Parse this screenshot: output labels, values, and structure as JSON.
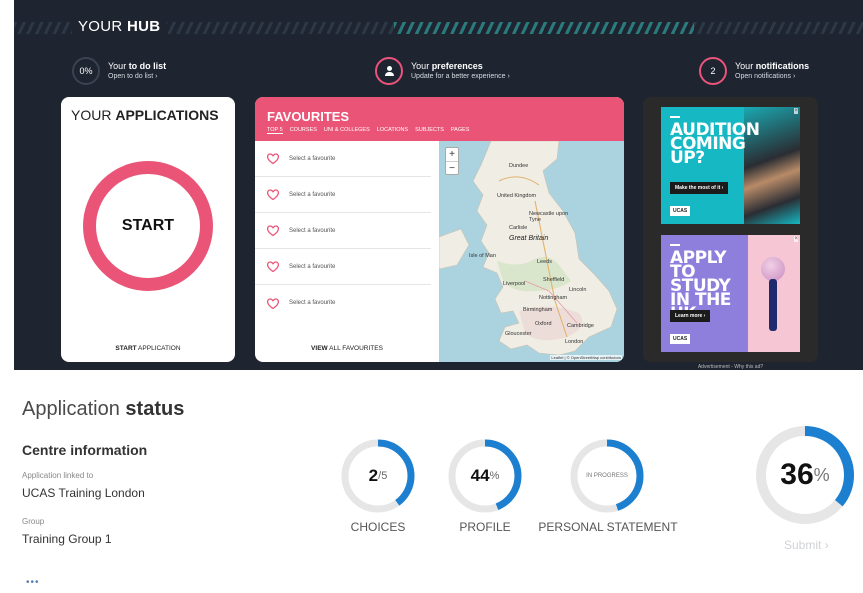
{
  "hub": {
    "title_prefix": "YOUR ",
    "title_bold": "HUB",
    "todo": {
      "circle": "0%",
      "prefix": "Your ",
      "bold": "to do list",
      "link": "Open to do list ›"
    },
    "preferences": {
      "prefix": "Your ",
      "bold": "preferences",
      "link": "Update for a better experience ›"
    },
    "notifications": {
      "circle": "2",
      "prefix": "Your ",
      "bold": "notifications",
      "link": "Open notifications ›"
    }
  },
  "applications": {
    "title_prefix": "YOUR ",
    "title_bold": "APPLICATIONS",
    "start": "START",
    "link_bold": "START",
    "link_rest": " APPLICATION"
  },
  "favourites": {
    "title": "FAVOURITES",
    "tabs": [
      "TOP 5",
      "COURSES",
      "UNI & COLLEGES",
      "LOCATIONS",
      "SUBJECTS",
      "PAGES"
    ],
    "items": [
      "Select a favourite",
      "Select a favourite",
      "Select a favourite",
      "Select a favourite",
      "Select a favourite"
    ],
    "view_bold": "VIEW",
    "view_rest": " ALL FAVOURITES",
    "map": {
      "zoom_in": "+",
      "zoom_out": "−",
      "labels": [
        "Dundee",
        "United Kingdom",
        "Newcastle upon Tyne",
        "Great Britain",
        "Leeds",
        "Sheffield",
        "Liverpool",
        "Nottingham",
        "Birmingham",
        "Cambridge",
        "London",
        "Gloucester",
        "Oxford",
        "Isle of Man",
        "Carlisle",
        "Lincoln"
      ],
      "attribution": "Leaflet | © OpenStreetMap contributors"
    }
  },
  "ads": {
    "ad1": {
      "headline": "AUDITION COMING UP?",
      "cta": "Make the most of it ›",
      "logo": "UCAS"
    },
    "ad2": {
      "headline": "APPLY TO STUDY IN THE UK",
      "cta": "Learn more ›",
      "logo": "UCAS"
    },
    "close": "×",
    "footer": "Advertisement - Why this ad?"
  },
  "status": {
    "title_light": "Application ",
    "title_bold": "status",
    "centre_heading": "Centre information",
    "linked_label": "Application linked to",
    "linked_value": "UCAS Training London",
    "group_label": "Group",
    "group_value": "Training Group 1",
    "gauges": [
      {
        "value": "2",
        "suffix": "/5",
        "label": "CHOICES",
        "fraction": 0.4
      },
      {
        "value": "44",
        "suffix": "%",
        "label": "PROFILE",
        "fraction": 0.44
      },
      {
        "value": "IN PROGRESS",
        "suffix": "",
        "label": "PERSONAL STATEMENT",
        "fraction": 0.45
      }
    ],
    "overall": {
      "value": "36",
      "suffix": "%",
      "fraction": 0.36
    },
    "submit": "Submit ›",
    "more": "•••"
  },
  "colors": {
    "hub_bg": "#1e2430",
    "accent_pink": "#ea5577",
    "gauge_blue": "#1d7fd0",
    "gauge_track": "#e6e6e6"
  }
}
